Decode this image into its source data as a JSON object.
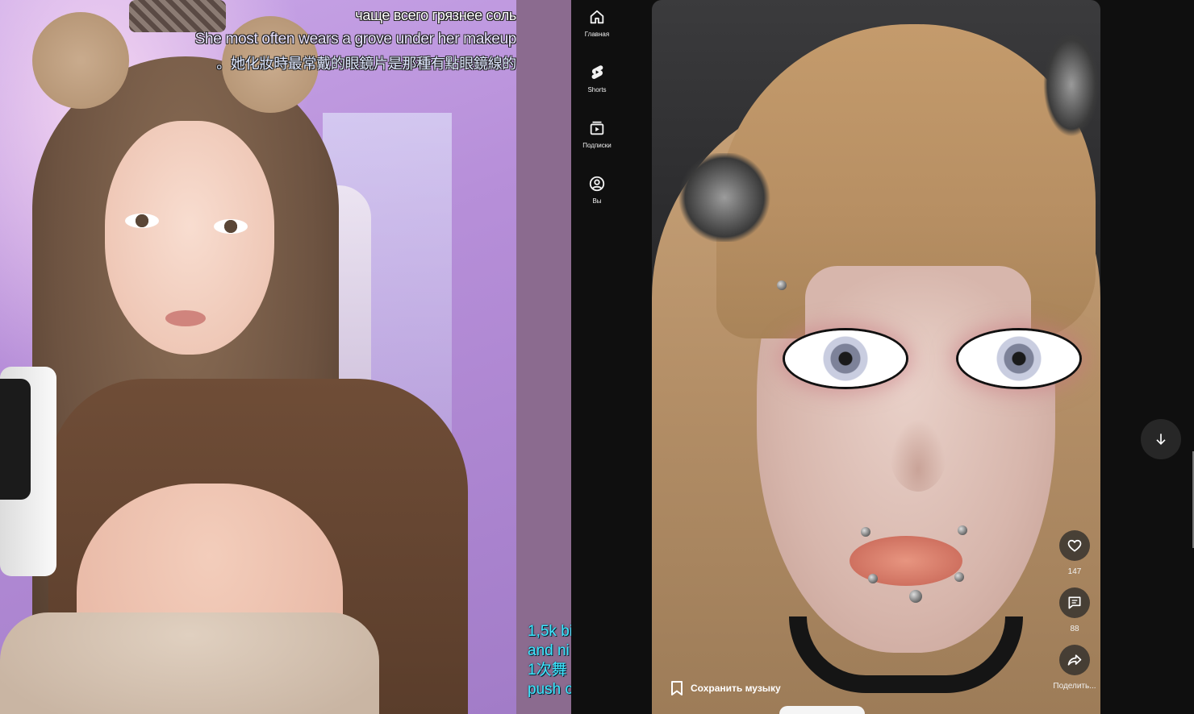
{
  "subtitles": {
    "ru": "чаще всего грязнее соль",
    "en": "She most often wears a grove under her makeup",
    "zh": "。她化妝時最常戴的眼鏡片是那種有點眼鏡線的"
  },
  "chat_overlay": {
    "lines": [
      "1,5k bi",
      "and ni",
      "1次舞",
      "push c"
    ]
  },
  "nav": {
    "items": [
      {
        "label": "Главная",
        "icon": "home-icon"
      },
      {
        "label": "Shorts",
        "icon": "shorts-icon"
      },
      {
        "label": "Подписки",
        "icon": "subscriptions-icon"
      },
      {
        "label": "Вы",
        "icon": "you-icon"
      }
    ]
  },
  "short": {
    "music_label": "Сохранить музыку",
    "likes": "147",
    "comments": "88",
    "share_label": "Поделить..."
  },
  "colors": {
    "accent_subtitle": "#e9e3ff",
    "chat_text": "#3fe6ff",
    "strip": "#8b6b8f",
    "yt_bg": "#0f0f0f"
  }
}
